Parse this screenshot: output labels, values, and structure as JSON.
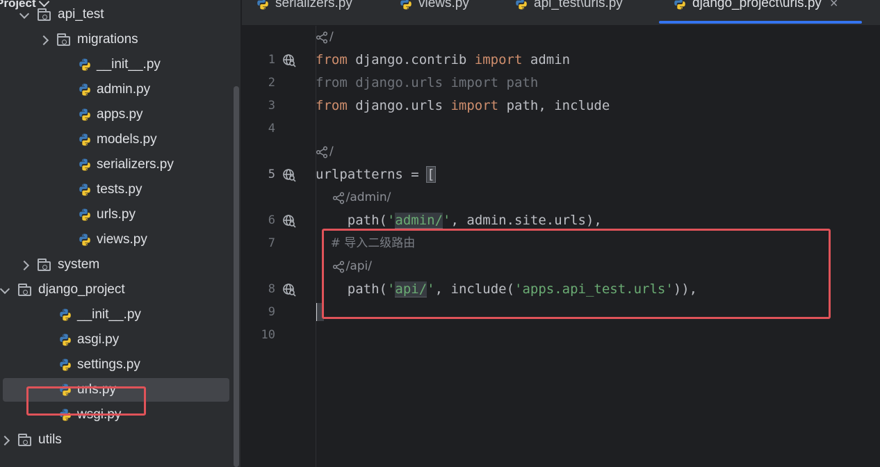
{
  "sidebar": {
    "title": "Project",
    "rows": [
      {
        "label": "api_test",
        "kind": "folder",
        "expanded": true
      },
      {
        "label": "migrations",
        "kind": "folder",
        "expanded": false
      },
      {
        "label": "__init__.py",
        "kind": "py"
      },
      {
        "label": "admin.py",
        "kind": "py"
      },
      {
        "label": "apps.py",
        "kind": "py"
      },
      {
        "label": "models.py",
        "kind": "py"
      },
      {
        "label": "serializers.py",
        "kind": "py"
      },
      {
        "label": "tests.py",
        "kind": "py"
      },
      {
        "label": "urls.py",
        "kind": "py"
      },
      {
        "label": "views.py",
        "kind": "py"
      },
      {
        "label": "system",
        "kind": "folder",
        "expanded": false
      },
      {
        "label": "django_project",
        "kind": "folder",
        "expanded": true
      },
      {
        "label": "__init__.py",
        "kind": "py"
      },
      {
        "label": "asgi.py",
        "kind": "py"
      },
      {
        "label": "settings.py",
        "kind": "py"
      },
      {
        "label": "urls.py",
        "kind": "py",
        "selected": true
      },
      {
        "label": "wsgi.py",
        "kind": "py"
      },
      {
        "label": "utils",
        "kind": "folder",
        "expanded": false
      }
    ]
  },
  "tabs": [
    {
      "label": "serializers.py"
    },
    {
      "label": "views.py"
    },
    {
      "label": "api_test\\urls.py"
    },
    {
      "label": "django_project\\urls.py",
      "active": true
    }
  ],
  "editor": {
    "hints": {
      "root": "/",
      "admin": "/admin/",
      "api": "/api/"
    },
    "line_numbers": [
      "1",
      "2",
      "3",
      "4",
      "5",
      "6",
      "7",
      "8",
      "9",
      "10"
    ],
    "code": {
      "l1_from": "from",
      "l1_mod": " django.contrib ",
      "l1_import": "import",
      "l1_name": " admin",
      "l2": "from django.urls import path",
      "l3_from": "from",
      "l3_mod": " django.urls ",
      "l3_import": "import",
      "l3_names": " path, include",
      "l5_name": "urlpatterns = ",
      "l5_bracket": "[",
      "l6_pre": "    path(",
      "l6_q1": "'",
      "l6_str": "admin/",
      "l6_q2": "'",
      "l6_post": ", admin.site.urls),",
      "l7_comment": "    # 导入二级路由",
      "l8_pre": "    path(",
      "l8_q1": "'",
      "l8_str": "api/",
      "l8_q2": "'",
      "l8_mid": ", include(",
      "l8_str2": "'apps.api_test.urls'",
      "l8_post": ")),"
    }
  },
  "colors": {
    "keyword": "#cf8e6d",
    "string": "#6aab73",
    "highlight_box": "#e05359",
    "accent": "#3574f0"
  }
}
